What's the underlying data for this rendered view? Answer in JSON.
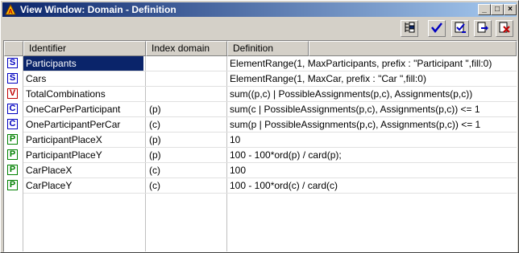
{
  "window": {
    "title": "View Window: Domain - Definition"
  },
  "window_controls": {
    "minimize": "_",
    "maximize": "□",
    "close": "×"
  },
  "toolbar": {
    "buttons": [
      {
        "name": "view-tree-button",
        "icon": "tree-view-icon"
      },
      {
        "name": "check-button",
        "icon": "checkmark-icon"
      },
      {
        "name": "check-commit-button",
        "icon": "check-commit-icon"
      },
      {
        "name": "export-button",
        "icon": "export-arrow-icon"
      },
      {
        "name": "discard-button",
        "icon": "discard-x-icon"
      }
    ]
  },
  "columns": {
    "identifier": "Identifier",
    "index_domain": "Index domain",
    "definition": "Definition"
  },
  "rows": [
    {
      "type": "S",
      "identifier": "Participants",
      "index_domain": "",
      "definition": "ElementRange(1, MaxParticipants, prefix : \"Participant \",fill:0)",
      "selected": true
    },
    {
      "type": "S",
      "identifier": "Cars",
      "index_domain": "",
      "definition": "ElementRange(1, MaxCar, prefix : \"Car \",fill:0)"
    },
    {
      "type": "V",
      "identifier": "TotalCombinations",
      "index_domain": "",
      "definition": "sum((p,c) | PossibleAssignments(p,c), Assignments(p,c))"
    },
    {
      "type": "C",
      "identifier": "OneCarPerParticipant",
      "index_domain": "(p)",
      "definition": "sum(c | PossibleAssignments(p,c), Assignments(p,c)) <= 1"
    },
    {
      "type": "C",
      "identifier": "OneParticipantPerCar",
      "index_domain": "(c)",
      "definition": "sum(p | PossibleAssignments(p,c), Assignments(p,c)) <= 1"
    },
    {
      "type": "P",
      "identifier": "ParticipantPlaceX",
      "index_domain": "(p)",
      "definition": "10"
    },
    {
      "type": "P",
      "identifier": "ParticipantPlaceY",
      "index_domain": "(p)",
      "definition": "100 - 100*ord(p) / card(p);"
    },
    {
      "type": "P",
      "identifier": "CarPlaceX",
      "index_domain": "(c)",
      "definition": "100"
    },
    {
      "type": "P",
      "identifier": "CarPlaceY",
      "index_domain": "(c)",
      "definition": "100 - 100*ord(c) / card(c)"
    }
  ],
  "colors": {
    "title_start": "#0a246a",
    "title_end": "#a6caf0",
    "selection": "#0a246a",
    "set_badge": "#0000c0",
    "variable_badge": "#c00000",
    "constraint_badge": "#0000c0",
    "parameter_badge": "#008000"
  }
}
